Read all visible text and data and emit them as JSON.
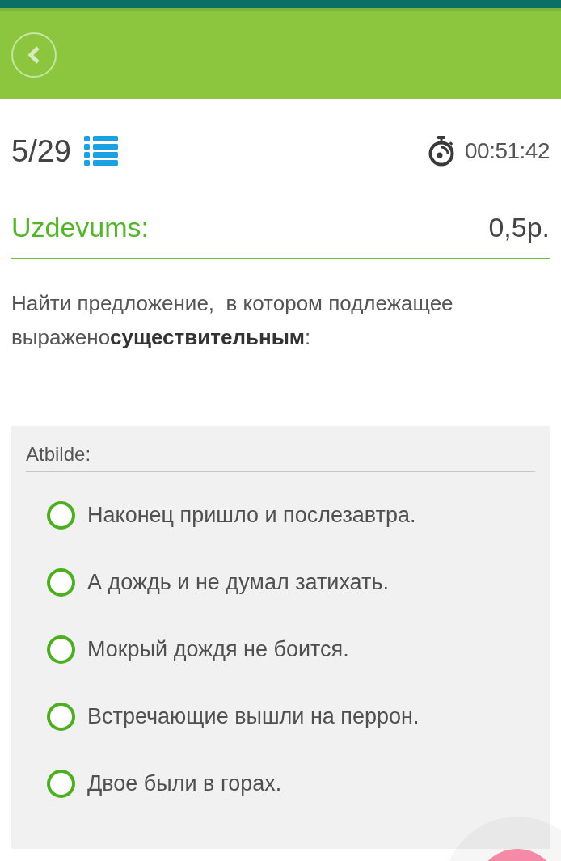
{
  "progress": {
    "counter": "5/29"
  },
  "timer": {
    "time": "00:51:42"
  },
  "task": {
    "label": "Uzdevums:",
    "points": "0,5p.",
    "question": "Найти предложение,  в котором подлежащее выражено**существительным**:"
  },
  "answer": {
    "label": "Atbilde:",
    "options": [
      {
        "text": "Наконец пришло и послезавтра.",
        "selected": false
      },
      {
        "text": "А дождь и не думал затихать.",
        "selected": false
      },
      {
        "text": "Мокрый дождя не боится.",
        "selected": false
      },
      {
        "text": "Встречающие вышли на перрон.",
        "selected": false
      },
      {
        "text": "Двое были в горах.",
        "selected": false
      }
    ]
  }
}
